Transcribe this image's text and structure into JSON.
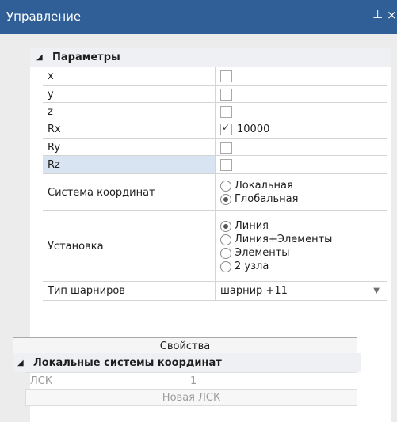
{
  "window": {
    "title": "Управление",
    "pin_glyph": "ᴾ",
    "close_glyph": "×"
  },
  "params": {
    "section_label": "Параметры",
    "rows": [
      {
        "name": "x",
        "checked": false,
        "value": ""
      },
      {
        "name": "y",
        "checked": false,
        "value": ""
      },
      {
        "name": "z",
        "checked": false,
        "value": ""
      },
      {
        "name": "Rx",
        "checked": true,
        "value": "10000"
      },
      {
        "name": "Ry",
        "checked": false,
        "value": ""
      },
      {
        "name": "Rz",
        "checked": false,
        "value": ""
      }
    ],
    "coord_system": {
      "label": "Система координат",
      "options": [
        "Локальная",
        "Глобальная"
      ],
      "selected": 1
    },
    "install": {
      "label": "Установка",
      "options": [
        "Линия",
        "Линия+Элементы",
        "Элементы",
        "2 узла"
      ],
      "selected": 0
    },
    "hinge_type": {
      "label": "Тип шарниров",
      "value": "шарнир +11"
    },
    "properties_button": "Свойства"
  },
  "local_cs": {
    "section_label": "Локальные системы координат",
    "lsk_label": "ЛСК",
    "lsk_value": "1",
    "new_button": "Новая ЛСК"
  }
}
